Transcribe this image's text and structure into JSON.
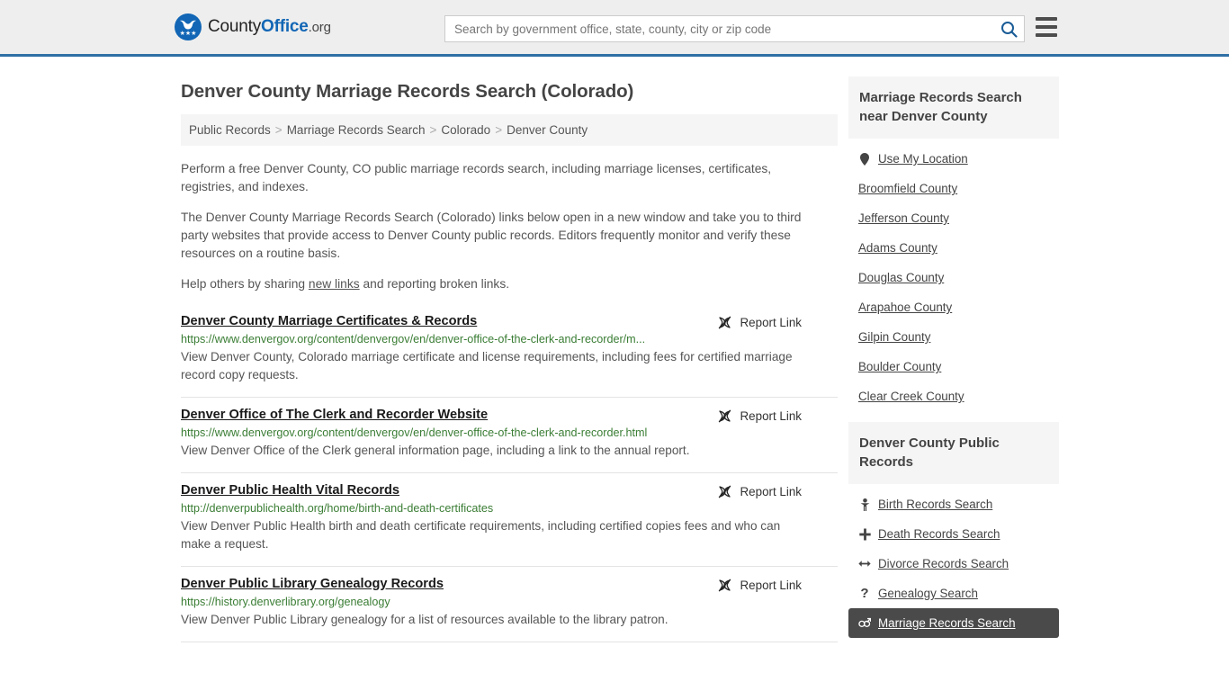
{
  "header": {
    "logo_text_1": "County",
    "logo_text_2": "Office",
    "logo_text_3": ".org",
    "logo_stars": "★★★",
    "search_placeholder": "Search by government office, state, county, city or zip code",
    "search_value": "",
    "search_icon": "search-icon",
    "menu_icon": "hamburger-menu-icon"
  },
  "page": {
    "title": "Denver County Marriage Records Search (Colorado)"
  },
  "breadcrumb": {
    "items": [
      {
        "label": "Public Records"
      },
      {
        "label": "Marriage Records Search"
      },
      {
        "label": "Colorado"
      },
      {
        "label": "Denver County"
      }
    ],
    "separator": ">"
  },
  "intro": {
    "p1": "Perform a free Denver County, CO public marriage records search, including marriage licenses, certificates, registries, and indexes.",
    "p2": "The Denver County Marriage Records Search (Colorado) links below open in a new window and take you to third party websites that provide access to Denver County public records. Editors frequently monitor and verify these resources on a routine basis.",
    "p3_before": "Help others by sharing ",
    "p3_link": "new links",
    "p3_after": " and reporting broken links."
  },
  "results": {
    "report_label": "Report Link",
    "report_icon": "broken-link-icon",
    "items": [
      {
        "title": "Denver County Marriage Certificates & Records",
        "url": "https://www.denvergov.org/content/denvergov/en/denver-office-of-the-clerk-and-recorder/m...",
        "desc": "View Denver County, Colorado marriage certificate and license requirements, including fees for certified marriage record copy requests."
      },
      {
        "title": "Denver Office of The Clerk and Recorder Website",
        "url": "https://www.denvergov.org/content/denvergov/en/denver-office-of-the-clerk-and-recorder.html",
        "desc": "View Denver Office of the Clerk general information page, including a link to the annual report."
      },
      {
        "title": "Denver Public Health Vital Records",
        "url": "http://denverpublichealth.org/home/birth-and-death-certificates",
        "desc": "View Denver Public Health birth and death certificate requirements, including certified copies fees and who can make a request."
      },
      {
        "title": "Denver Public Library Genealogy Records",
        "url": "https://history.denverlibrary.org/genealogy",
        "desc": "View Denver Public Library genealogy for a list of resources available to the library patron."
      }
    ]
  },
  "sidebar": {
    "nearby": {
      "heading": "Marriage Records Search near Denver County",
      "items": [
        {
          "label": "Use My Location",
          "icon": "map-pin-icon"
        },
        {
          "label": "Broomfield County",
          "icon": ""
        },
        {
          "label": "Jefferson County",
          "icon": ""
        },
        {
          "label": "Adams County",
          "icon": ""
        },
        {
          "label": "Douglas County",
          "icon": ""
        },
        {
          "label": "Arapahoe County",
          "icon": ""
        },
        {
          "label": "Gilpin County",
          "icon": ""
        },
        {
          "label": "Boulder County",
          "icon": ""
        },
        {
          "label": "Clear Creek County",
          "icon": ""
        }
      ]
    },
    "public_records": {
      "heading": "Denver County Public Records",
      "items": [
        {
          "label": "Birth Records Search",
          "icon": "baby-icon",
          "active": false
        },
        {
          "label": "Death Records Search",
          "icon": "cross-icon",
          "active": false
        },
        {
          "label": "Divorce Records Search",
          "icon": "left-right-arrow-icon",
          "active": false
        },
        {
          "label": "Genealogy Search",
          "icon": "question-mark-icon",
          "active": false
        },
        {
          "label": "Marriage Records Search",
          "icon": "gender-symbols-icon",
          "active": true
        }
      ]
    }
  },
  "colors": {
    "header_bg": "#eeeeee",
    "header_border": "#2f6fa5",
    "brand_blue": "#1266b5",
    "url_green": "#3a7d34",
    "panel_bg": "#f5f5f5",
    "active_bg": "#4a4a4a",
    "text": "#555555"
  }
}
